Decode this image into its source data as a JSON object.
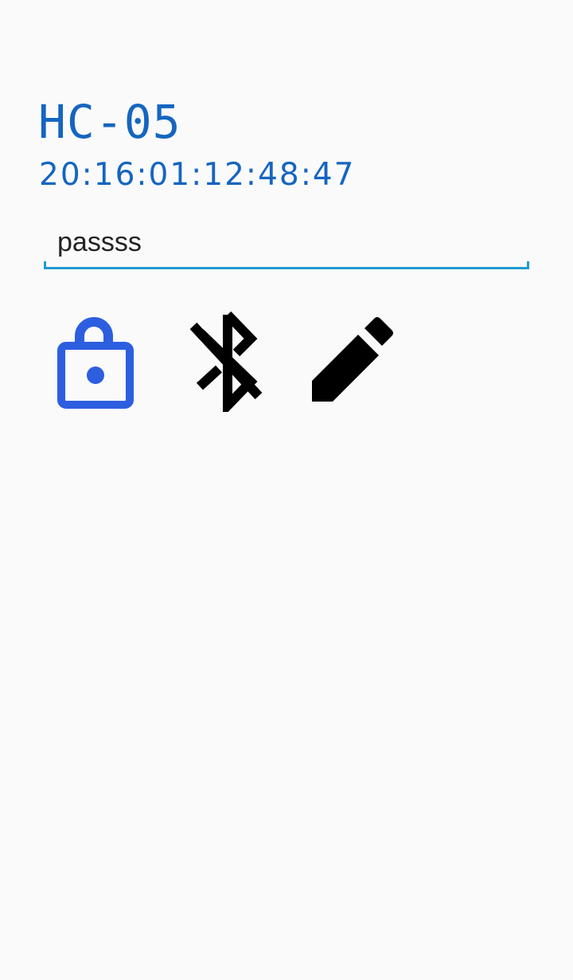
{
  "device": {
    "name": "HC-05",
    "address": "20:16:01:12:48:47"
  },
  "password_field": {
    "value": "passss"
  },
  "actions": [
    {
      "icon": "unlock-icon",
      "color": "#2d5ee0"
    },
    {
      "icon": "bluetooth-disabled-icon",
      "color": "#000000"
    },
    {
      "icon": "pencil-icon",
      "color": "#000000"
    }
  ],
  "colors": {
    "accent_text": "#1565c0",
    "field_underline": "#1e9bd1",
    "background": "#fafafa"
  }
}
